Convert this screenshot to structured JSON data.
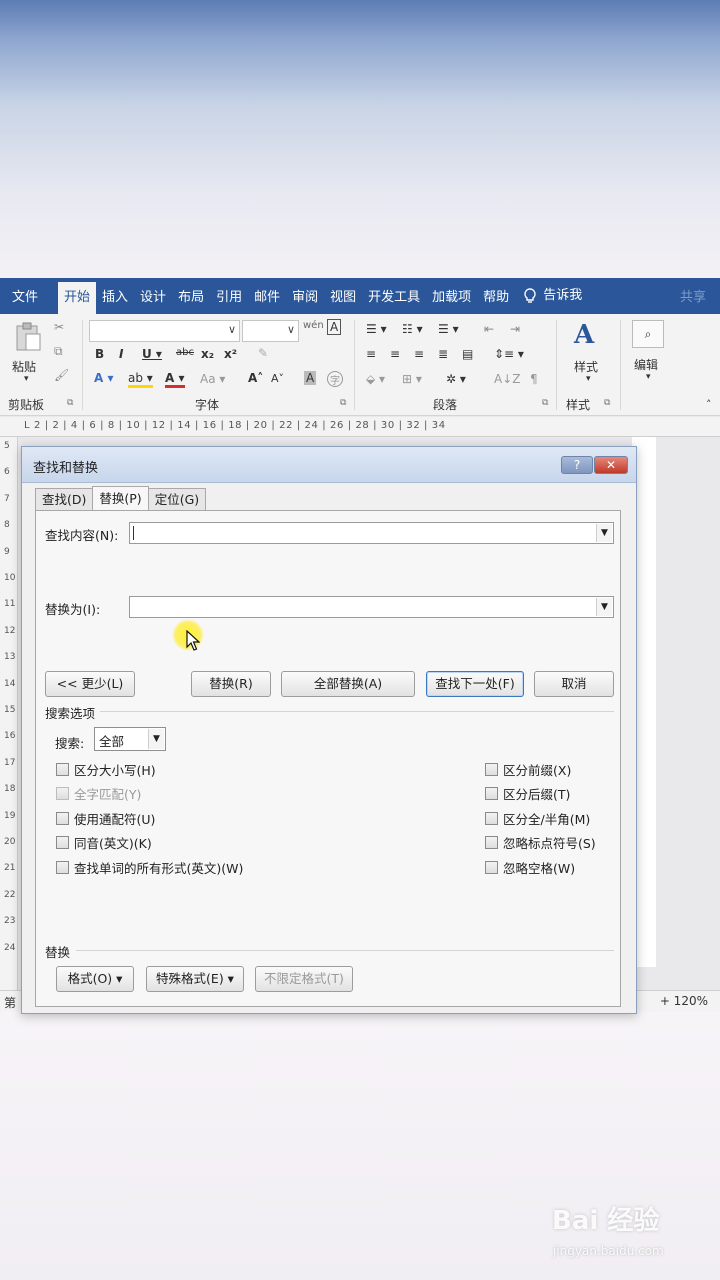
{
  "ribbon": {
    "tabs": [
      "文件",
      "开始",
      "插入",
      "设计",
      "布局",
      "引用",
      "邮件",
      "审阅",
      "视图",
      "开发工具",
      "加载项",
      "帮助"
    ],
    "active_tab": "开始",
    "tell_me": "告诉我",
    "share": "共享",
    "paste_label": "粘贴",
    "clipboard_group": "剪贴板",
    "font_group": "字体",
    "paragraph_group": "段落",
    "styles_group": "样式",
    "styles_label": "样式",
    "edit_label": "编辑",
    "accent_color": "#2b579a"
  },
  "ruler": {
    "marks": "L  2 | 2 | 4 | 6 | 8 | 10 | 12 | 14 | 16 | 18 | 20 | 22 | 24 | 26 | 28 | 30 | 32 | 34"
  },
  "vertical_ruler": [
    "5",
    "6",
    "7",
    "8",
    "9",
    "10",
    "11",
    "12",
    "13",
    "14",
    "15",
    "16",
    "17",
    "18",
    "19",
    "20",
    "21",
    "22",
    "23",
    "24"
  ],
  "status": {
    "page": "第",
    "zoom": "+ 120%"
  },
  "dialog": {
    "title": "查找和替换",
    "help_button": "?",
    "close_button": "✕",
    "tabs": [
      "查找(D)",
      "替换(P)",
      "定位(G)"
    ],
    "active_tab": "替换(P)",
    "find_label": "查找内容(N):",
    "find_value": "",
    "replace_label": "替换为(I):",
    "replace_value": "",
    "buttons": {
      "less": "<< 更少(L)",
      "replace": "替换(R)",
      "replace_all": "全部替换(A)",
      "find_next": "查找下一处(F)",
      "cancel": "取消"
    },
    "search_options_title": "搜索选项",
    "search_label": "搜索:",
    "search_value": "全部",
    "left_options": [
      {
        "label": "区分大小写(H)",
        "checked": false,
        "enabled": true
      },
      {
        "label": "全字匹配(Y)",
        "checked": false,
        "enabled": false
      },
      {
        "label": "使用通配符(U)",
        "checked": false,
        "enabled": true
      },
      {
        "label": "同音(英文)(K)",
        "checked": false,
        "enabled": true
      },
      {
        "label": "查找单词的所有形式(英文)(W)",
        "checked": false,
        "enabled": true
      }
    ],
    "right_options": [
      {
        "label": "区分前缀(X)",
        "checked": false,
        "enabled": true
      },
      {
        "label": "区分后缀(T)",
        "checked": false,
        "enabled": true
      },
      {
        "label": "区分全/半角(M)",
        "checked": false,
        "enabled": true
      },
      {
        "label": "忽略标点符号(S)",
        "checked": false,
        "enabled": true
      },
      {
        "label": "忽略空格(W)",
        "checked": false,
        "enabled": true
      }
    ],
    "replace_section_title": "替换",
    "format_button": "格式(O) ▾",
    "special_button": "特殊格式(E) ▾",
    "no_format_button": "不限定格式(T)"
  },
  "watermark": {
    "brand": "Bai 经验",
    "url": "jingyan.baidu.com"
  }
}
